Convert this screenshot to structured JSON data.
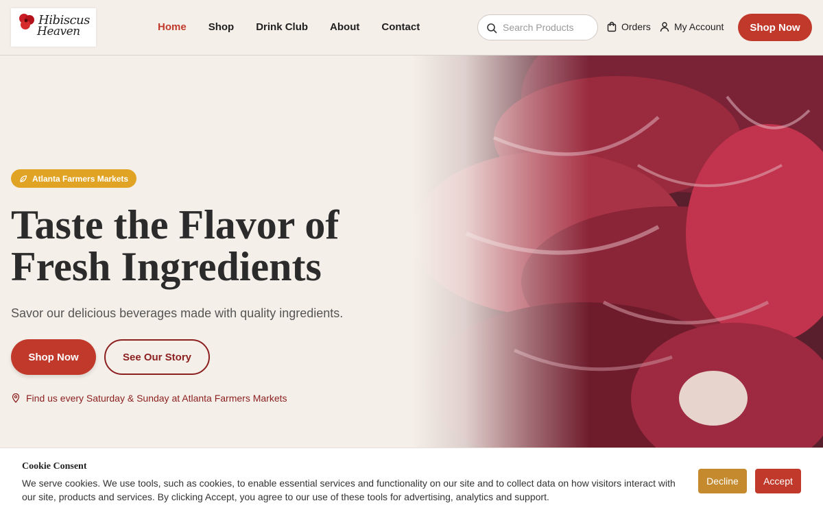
{
  "brand": {
    "logo_line1": "Hibiscus",
    "logo_line2": "Heaven",
    "accent": "#c0392b",
    "gold": "#e0a324"
  },
  "nav": [
    {
      "label": "Home",
      "active": true
    },
    {
      "label": "Shop"
    },
    {
      "label": "Drink Club"
    },
    {
      "label": "About"
    },
    {
      "label": "Contact"
    }
  ],
  "search": {
    "placeholder": "Search Products",
    "icon": "search-icon"
  },
  "header": {
    "orders_label": "Orders",
    "account_label": "My Account",
    "shop_now_label": "Shop Now"
  },
  "hero": {
    "badge": "Atlanta Farmers Markets",
    "title_line1": "Taste the Flavor of",
    "title_line2": "Fresh Ingredients",
    "subtitle": "Savor our delicious beverages made with quality ingredients.",
    "primary_button": "Shop Now",
    "secondary_button": "See Our Story",
    "location_text": "Find us every Saturday & Sunday at Atlanta Farmers Markets"
  },
  "cookie": {
    "title": "Cookie Consent",
    "text": "We serve cookies. We use tools, such as cookies, to enable essential services and functionality on our site and to collect data on how visitors interact with our site, products and services. By clicking Accept, you agree to our use of these tools for advertising, analytics and support.",
    "decline_label": "Decline",
    "accept_label": "Accept"
  }
}
